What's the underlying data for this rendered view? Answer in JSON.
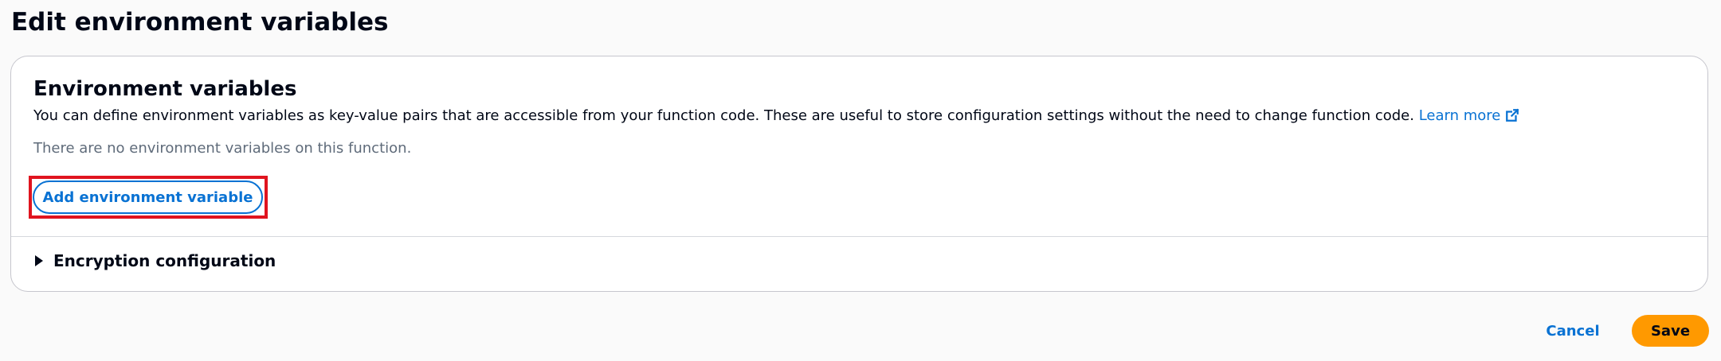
{
  "page": {
    "title": "Edit environment variables"
  },
  "env_section": {
    "title": "Environment variables",
    "description": "You can define environment variables as key-value pairs that are accessible from your function code. These are useful to store configuration settings without the need to change function code.",
    "learn_more": "Learn more",
    "learn_more_icon": "external-link-icon",
    "empty_message": "There are no environment variables on this function.",
    "add_button": "Add environment variable"
  },
  "encryption": {
    "label": "Encryption configuration",
    "icon": "caret-right-icon",
    "expanded": false
  },
  "footer": {
    "cancel": "Cancel",
    "save": "Save"
  },
  "colors": {
    "link": "#0972d3",
    "primary_button": "#ff9900",
    "highlight": "#e0141f",
    "text": "#000716",
    "muted_text": "#5f6b7a"
  }
}
